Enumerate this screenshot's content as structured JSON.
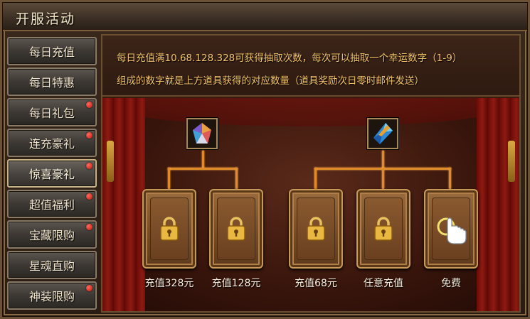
{
  "window": {
    "title": "开服活动"
  },
  "sidebar": {
    "items": [
      {
        "label": "每日充值",
        "badge": false
      },
      {
        "label": "每日特惠",
        "badge": false
      },
      {
        "label": "每日礼包",
        "badge": true
      },
      {
        "label": "连充豪礼",
        "badge": true
      },
      {
        "label": "惊喜豪礼",
        "badge": true,
        "active": true
      },
      {
        "label": "超值福利",
        "badge": true
      },
      {
        "label": "宝藏限购",
        "badge": true
      },
      {
        "label": "星魂直购",
        "badge": false
      },
      {
        "label": "神装限购",
        "badge": true
      }
    ]
  },
  "notice": {
    "line1": "每日充值满10.68.128.328可获得抽取次数，每次可以抽取一个幸运数字（1-9）",
    "line2": "组成的数字就是上方道具获得的对应数量（道具奖励次日零时邮件发送）"
  },
  "rewards": {
    "item1_icon": "colorful-gem-icon",
    "item2_icon": "blue-crystal-icon"
  },
  "cards": [
    {
      "label": "充值328元",
      "state": "locked"
    },
    {
      "label": "充值128元",
      "state": "locked"
    },
    {
      "label": "充值68元",
      "state": "locked"
    },
    {
      "label": "任意充值",
      "state": "locked"
    },
    {
      "label": "免费",
      "state": "available"
    }
  ],
  "colors": {
    "notice_text": "#f3c46a",
    "badge": "#d0180e",
    "connector": "#e08a2a"
  }
}
